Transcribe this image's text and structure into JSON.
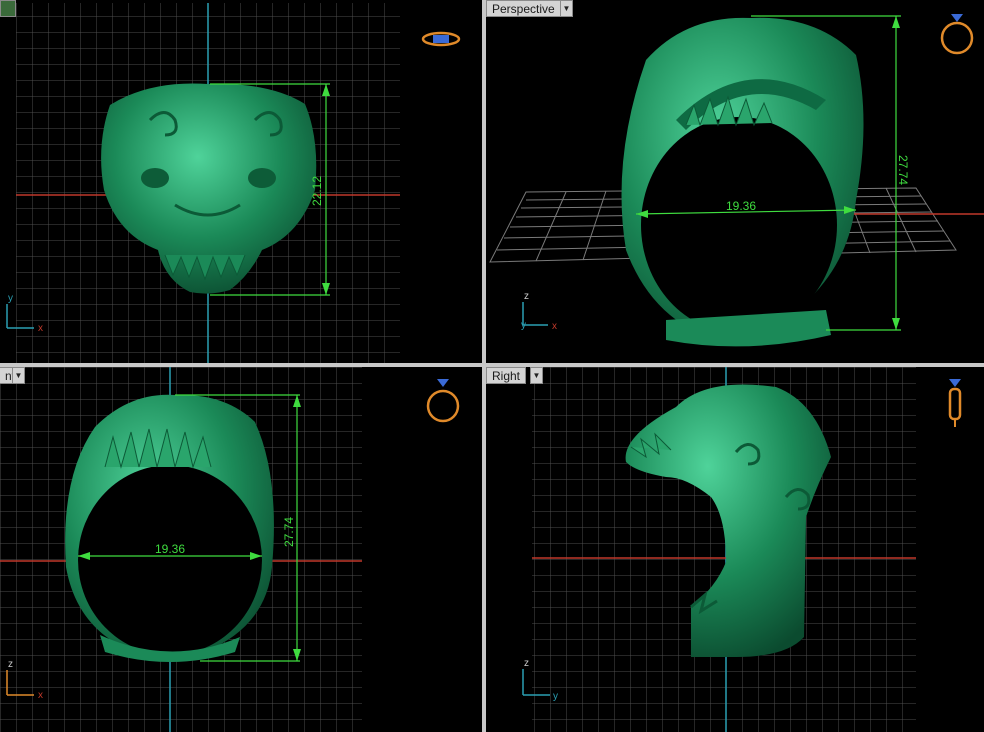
{
  "viewports": {
    "top": {
      "label": "",
      "dimension": "22.12"
    },
    "perspective": {
      "label": "Perspective",
      "dimension_width": "19.36",
      "dimension_height": "27.74"
    },
    "front": {
      "label": "nt",
      "dimension_width": "19.36",
      "dimension_height": "27.74"
    },
    "right": {
      "label": "Right"
    }
  },
  "axes": {
    "top": {
      "a": "y",
      "b": "x"
    },
    "perspective": {
      "a": "z",
      "b": "x",
      "c": "y"
    },
    "front": {
      "a": "z",
      "b": "x"
    },
    "right": {
      "a": "z",
      "b": "y"
    }
  },
  "icons": {
    "top": "ring-top-view-icon",
    "perspective": "ring-perspective-icon",
    "front": "ring-front-view-icon",
    "right": "ring-side-view-icon"
  },
  "colors": {
    "model": "#1f8a5c",
    "grid": "#5a5a5a",
    "dimension": "#3fdc3f",
    "axis_x": "#c0392b",
    "axis_y": "#2a9fb3",
    "gizmo": "#e08a2a",
    "background": "#000000"
  }
}
